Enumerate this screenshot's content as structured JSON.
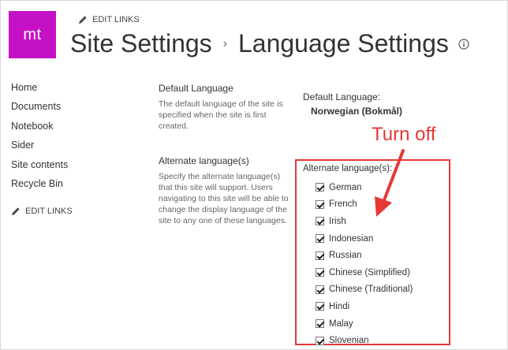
{
  "site": {
    "logo_text": "mt",
    "logo_color": "#c511c6"
  },
  "header": {
    "edit_links": "EDIT LINKS",
    "breadcrumb_root": "Site Settings",
    "breadcrumb_sep": "›",
    "page_title": "Language Settings"
  },
  "nav": {
    "items": [
      {
        "label": "Home"
      },
      {
        "label": "Documents"
      },
      {
        "label": "Notebook"
      },
      {
        "label": "Sider"
      },
      {
        "label": "Site contents"
      },
      {
        "label": "Recycle Bin"
      }
    ],
    "edit_links": "EDIT LINKS"
  },
  "default_language": {
    "section_title": "Default Language",
    "description": "The default language of the site is specified when the site is first created.",
    "label": "Default Language:",
    "value": "Norwegian (Bokmål)"
  },
  "alternate_languages": {
    "section_title": "Alternate language(s)",
    "description": "Specify the alternate language(s) that this site will support. Users navigating to this site will be able to change the display language of the site to any one of these languages.",
    "label": "Alternate language(s):",
    "items": [
      {
        "label": "German",
        "checked": true
      },
      {
        "label": "French",
        "checked": true
      },
      {
        "label": "Irish",
        "checked": true
      },
      {
        "label": "Indonesian",
        "checked": true
      },
      {
        "label": "Russian",
        "checked": true
      },
      {
        "label": "Chinese (Simplified)",
        "checked": true
      },
      {
        "label": "Chinese (Traditional)",
        "checked": true
      },
      {
        "label": "Hindi",
        "checked": true
      },
      {
        "label": "Malay",
        "checked": true
      },
      {
        "label": "Slovenian",
        "checked": true
      }
    ]
  },
  "annotation": {
    "text": "Turn off",
    "color": "#e53935"
  }
}
